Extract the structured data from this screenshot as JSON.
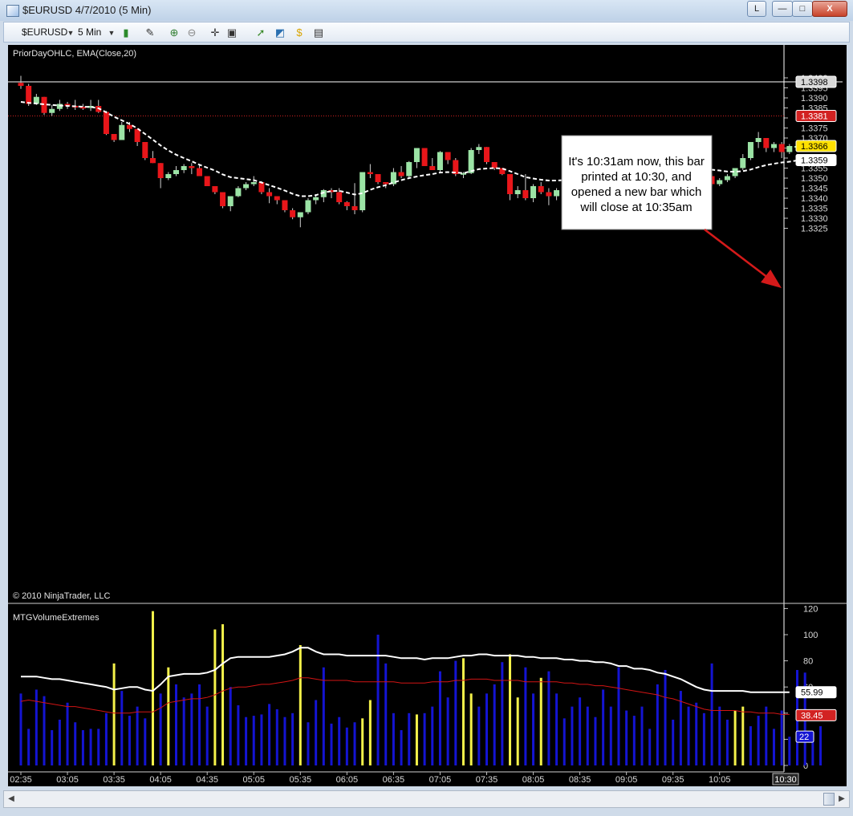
{
  "window": {
    "title": "$EURUSD  4/7/2010 (5 Min)",
    "controls": {
      "shortcut": "L",
      "minimize": "—",
      "maximize": "□",
      "close": "X"
    }
  },
  "toolbar": {
    "instrument": "$EURUSD",
    "interval": "5 Min"
  },
  "colors": {
    "background": "#000000",
    "up": "#9be3a5",
    "down": "#e8161a",
    "ema": "#ffffff",
    "volume_normal": "#1414d2",
    "volume_extreme": "#f5f24a",
    "band_upper": "#ffffff",
    "band_lower": "#d21414"
  },
  "chart_data": [
    {
      "type": "candlestick",
      "indicator_label": "PriorDayOHLC, EMA(Close,20)",
      "copyright": "© 2010 NinjaTrader, LLC",
      "ylim": [
        1.3322,
        1.3404
      ],
      "y_ticks": [
        "1.3400",
        "1.3395",
        "1.3390",
        "1.3385",
        "1.3380",
        "1.3375",
        "1.3370",
        "1.3365",
        "1.3360",
        "1.3355",
        "1.3350",
        "1.3345",
        "1.3340",
        "1.3335",
        "1.3330",
        "1.3325"
      ],
      "x_ticks": [
        "02:35",
        "03:05",
        "03:35",
        "04:05",
        "04:35",
        "05:05",
        "05:35",
        "06:05",
        "06:35",
        "07:05",
        "07:35",
        "08:05",
        "08:35",
        "09:05",
        "09:35",
        "10:05"
      ],
      "last_time_label": "10:30",
      "prior_high": 1.3398,
      "prior_close": 1.3381,
      "last_price": 1.3366,
      "ema_value": 1.3359,
      "price_labels": {
        "prior_high": "1.3398",
        "prior_close": "1.3381",
        "last": "1.3366",
        "ema": "1.3359"
      },
      "candles": [
        [
          1.33975,
          1.3401,
          1.33945,
          1.3396
        ],
        [
          1.3396,
          1.3397,
          1.3386,
          1.3387
        ],
        [
          1.3387,
          1.3392,
          1.33865,
          1.33905
        ],
        [
          1.33905,
          1.33905,
          1.33815,
          1.33825
        ],
        [
          1.33825,
          1.33865,
          1.3381,
          1.33845
        ],
        [
          1.33845,
          1.3389,
          1.33835,
          1.3387
        ],
        [
          1.3387,
          1.3388,
          1.33845,
          1.3386
        ],
        [
          1.3386,
          1.3389,
          1.3384,
          1.33855
        ],
        [
          1.33855,
          1.3387,
          1.3384,
          1.3385
        ],
        [
          1.3385,
          1.3389,
          1.33835,
          1.3386
        ],
        [
          1.3386,
          1.3389,
          1.33825,
          1.3383
        ],
        [
          1.3383,
          1.33835,
          1.33715,
          1.3372
        ],
        [
          1.3372,
          1.3372,
          1.3368,
          1.3369
        ],
        [
          1.3369,
          1.3378,
          1.3369,
          1.33765
        ],
        [
          1.33765,
          1.3378,
          1.3373,
          1.33745
        ],
        [
          1.33745,
          1.33745,
          1.3366,
          1.3368
        ],
        [
          1.3368,
          1.3368,
          1.3359,
          1.336
        ],
        [
          1.336,
          1.33635,
          1.33575,
          1.33575
        ],
        [
          1.33575,
          1.33575,
          1.3345,
          1.335
        ],
        [
          1.335,
          1.3353,
          1.3349,
          1.3352
        ],
        [
          1.3352,
          1.3356,
          1.3351,
          1.3354
        ],
        [
          1.3354,
          1.3357,
          1.33525,
          1.3356
        ],
        [
          1.3356,
          1.33575,
          1.3352,
          1.3355
        ],
        [
          1.3355,
          1.3357,
          1.3351,
          1.3351
        ],
        [
          1.3351,
          1.3351,
          1.3346,
          1.3346
        ],
        [
          1.3346,
          1.3346,
          1.3342,
          1.3343
        ],
        [
          1.3343,
          1.3343,
          1.3335,
          1.3336
        ],
        [
          1.3336,
          1.3336,
          1.33335,
          1.3341
        ],
        [
          1.3341,
          1.3346,
          1.33405,
          1.3345
        ],
        [
          1.3345,
          1.3348,
          1.3344,
          1.3347
        ],
        [
          1.3347,
          1.3351,
          1.3346,
          1.3348
        ],
        [
          1.3348,
          1.33485,
          1.3342,
          1.3343
        ],
        [
          1.3343,
          1.3345,
          1.33375,
          1.3341
        ],
        [
          1.3341,
          1.3341,
          1.3337,
          1.3339
        ],
        [
          1.3339,
          1.3339,
          1.3333,
          1.3334
        ],
        [
          1.3334,
          1.3335,
          1.33295,
          1.33305
        ],
        [
          1.33305,
          1.3333,
          1.33255,
          1.3333
        ],
        [
          1.3333,
          1.334,
          1.3332,
          1.3339
        ],
        [
          1.3339,
          1.3342,
          1.3337,
          1.33405
        ],
        [
          1.33405,
          1.33445,
          1.3338,
          1.3344
        ],
        [
          1.3344,
          1.3345,
          1.334,
          1.3343
        ],
        [
          1.3343,
          1.3345,
          1.3337,
          1.3338
        ],
        [
          1.3338,
          1.33385,
          1.3334,
          1.3336
        ],
        [
          1.3336,
          1.33475,
          1.3332,
          1.3334
        ],
        [
          1.3334,
          1.3353,
          1.3333,
          1.3353
        ],
        [
          1.3353,
          1.3357,
          1.335,
          1.3352
        ],
        [
          1.3352,
          1.3352,
          1.3347,
          1.3348
        ],
        [
          1.3348,
          1.3348,
          1.3345,
          1.3347
        ],
        [
          1.3347,
          1.3355,
          1.3346,
          1.3353
        ],
        [
          1.3353,
          1.3356,
          1.335,
          1.3351
        ],
        [
          1.3351,
          1.33585,
          1.335,
          1.3358
        ],
        [
          1.3358,
          1.3365,
          1.3355,
          1.3365
        ],
        [
          1.3365,
          1.3365,
          1.3356,
          1.3356
        ],
        [
          1.3356,
          1.336,
          1.3354,
          1.3354
        ],
        [
          1.3354,
          1.33635,
          1.3353,
          1.3363
        ],
        [
          1.3363,
          1.3363,
          1.3357,
          1.3359
        ],
        [
          1.3359,
          1.336,
          1.3351,
          1.3352
        ],
        [
          1.3352,
          1.3353,
          1.335,
          1.33525
        ],
        [
          1.33525,
          1.3365,
          1.3352,
          1.3364
        ],
        [
          1.3364,
          1.3367,
          1.3362,
          1.33655
        ],
        [
          1.33655,
          1.33655,
          1.3357,
          1.3358
        ],
        [
          1.3358,
          1.3358,
          1.3354,
          1.3355
        ],
        [
          1.3355,
          1.3355,
          1.33515,
          1.3352
        ],
        [
          1.3352,
          1.3352,
          1.3339,
          1.3342
        ],
        [
          1.3342,
          1.3346,
          1.334,
          1.3344
        ],
        [
          1.3344,
          1.3352,
          1.3339,
          1.334
        ],
        [
          1.334,
          1.3347,
          1.3338,
          1.3346
        ],
        [
          1.3346,
          1.3348,
          1.3342,
          1.3343
        ],
        [
          1.3343,
          1.3345,
          1.33365,
          1.3341
        ],
        [
          1.3341,
          1.3345,
          1.3339,
          1.3344
        ],
        [
          1.3344,
          1.3348,
          1.3341,
          1.3347
        ],
        [
          1.3347,
          1.335,
          1.3346,
          1.3349
        ],
        [
          1.3349,
          1.3356,
          1.3348,
          1.3355
        ],
        [
          1.3355,
          1.3358,
          1.3352,
          1.3353
        ],
        [
          1.3353,
          1.3359,
          1.335,
          1.3359
        ],
        [
          1.3359,
          1.3359,
          1.3349,
          1.3351
        ],
        [
          1.3351,
          1.3355,
          1.3347,
          1.3355
        ],
        [
          1.3355,
          1.3356,
          1.335,
          1.3353
        ],
        [
          1.3353,
          1.3355,
          1.3351,
          1.3354
        ],
        [
          1.3354,
          1.3361,
          1.3353,
          1.336
        ],
        [
          1.336,
          1.3364,
          1.3358,
          1.3363
        ],
        [
          1.3363,
          1.3365,
          1.336,
          1.3361
        ],
        [
          1.3361,
          1.3365,
          1.336,
          1.3364
        ],
        [
          1.3364,
          1.3366,
          1.3362,
          1.3365
        ],
        [
          1.3365,
          1.3366,
          1.3359,
          1.3361
        ],
        [
          1.3361,
          1.3362,
          1.3358,
          1.336
        ],
        [
          1.336,
          1.336,
          1.3355,
          1.3356
        ],
        [
          1.3356,
          1.3356,
          1.3352,
          1.3353
        ],
        [
          1.3353,
          1.3353,
          1.335,
          1.3351
        ],
        [
          1.3351,
          1.3352,
          1.3346,
          1.3347
        ],
        [
          1.3347,
          1.335,
          1.3346,
          1.3349
        ],
        [
          1.3349,
          1.3352,
          1.3348,
          1.3351
        ],
        [
          1.3351,
          1.33535,
          1.335,
          1.3355
        ],
        [
          1.3355,
          1.3362,
          1.3354,
          1.336
        ],
        [
          1.336,
          1.3368,
          1.3359,
          1.3368
        ],
        [
          1.3368,
          1.3373,
          1.3365,
          1.337
        ],
        [
          1.337,
          1.337,
          1.3363,
          1.3365
        ],
        [
          1.3365,
          1.3368,
          1.3363,
          1.3367
        ],
        [
          1.3367,
          1.3368,
          1.336,
          1.3363
        ],
        [
          1.3363,
          1.3367,
          1.3362,
          1.3366
        ],
        [
          1.3366,
          1.3366,
          1.3366,
          1.3366
        ]
      ],
      "ema": [
        1.3388,
        1.33875,
        1.33872,
        1.33868,
        1.33865,
        1.33862,
        1.3386,
        1.33858,
        1.33856,
        1.33855,
        1.33848,
        1.33828,
        1.33806,
        1.33788,
        1.3377,
        1.33748,
        1.3372,
        1.33692,
        1.33663,
        1.33638,
        1.33617,
        1.336,
        1.33584,
        1.33567,
        1.33552,
        1.33538,
        1.33518,
        1.33505,
        1.335,
        1.33495,
        1.3349,
        1.33478,
        1.33465,
        1.33452,
        1.33438,
        1.33422,
        1.3341,
        1.3341,
        1.33415,
        1.33428,
        1.33435,
        1.33437,
        1.33428,
        1.33418,
        1.33425,
        1.33442,
        1.33455,
        1.33465,
        1.33478,
        1.3349,
        1.335,
        1.33508,
        1.33515,
        1.3352,
        1.33528,
        1.3353,
        1.33528,
        1.33525,
        1.33535,
        1.33545,
        1.33548,
        1.3355,
        1.33548,
        1.33535,
        1.3352,
        1.33505,
        1.33498,
        1.33492,
        1.33488,
        1.33488,
        1.3349,
        1.33493,
        1.33499,
        1.33502,
        1.33508,
        1.33512,
        1.33518,
        1.3352,
        1.33525,
        1.33533,
        1.33542,
        1.33548,
        1.33553,
        1.33558,
        1.33562,
        1.33562,
        1.33558,
        1.33553,
        1.33548,
        1.33542,
        1.33538,
        1.33533,
        1.33532,
        1.33535,
        1.33543,
        1.33555,
        1.33565,
        1.33572,
        1.33578,
        1.33582,
        1.33588
      ]
    },
    {
      "type": "bar",
      "indicator_label": "MTGVolumeExtremes",
      "ylim": [
        0,
        120
      ],
      "y_ticks": [
        "120",
        "100",
        "80",
        "60",
        "40",
        "20",
        "0"
      ],
      "last_values": {
        "upper": "55.99",
        "lower": "38.45",
        "volume": "22"
      },
      "volume": [
        55,
        28,
        58,
        53,
        27,
        35,
        48,
        33,
        27,
        28,
        28,
        40,
        78,
        57,
        38,
        45,
        36,
        118,
        55,
        75,
        62,
        52,
        55,
        62,
        45,
        104,
        108,
        60,
        46,
        37,
        38,
        39,
        47,
        43,
        37,
        40,
        92,
        33,
        50,
        75,
        32,
        37,
        29,
        33,
        36,
        50,
        100,
        78,
        40,
        27,
        40,
        39,
        40,
        45,
        72,
        52,
        80,
        82,
        55,
        45,
        55,
        62,
        79,
        85,
        52,
        75,
        55,
        67,
        72,
        55,
        36,
        45,
        52,
        45,
        37,
        58,
        45,
        75,
        42,
        38,
        45,
        28,
        62,
        73,
        35,
        57,
        45,
        48,
        40,
        78,
        45,
        35,
        42,
        45,
        30,
        38,
        45,
        28,
        42,
        22,
        73,
        71,
        22,
        30
      ],
      "extreme": [
        12,
        17,
        19,
        25,
        26,
        36,
        44,
        45,
        51,
        57,
        58,
        63,
        64,
        67,
        92,
        93
      ],
      "upper_band": [
        68,
        68,
        68,
        67,
        66,
        66,
        65,
        64,
        63,
        62,
        61,
        60,
        58,
        59,
        60,
        60,
        58,
        57,
        62,
        68,
        69,
        70,
        70,
        70,
        71,
        73,
        78,
        82,
        83,
        83,
        83,
        83,
        83,
        84,
        85,
        87,
        90,
        90,
        87,
        85,
        85,
        85,
        84,
        84,
        84,
        84,
        84,
        84,
        83,
        82,
        82,
        82,
        81,
        82,
        82,
        82,
        83,
        84,
        84,
        85,
        85,
        84,
        84,
        84,
        84,
        83,
        83,
        82,
        82,
        82,
        81,
        81,
        80,
        80,
        79,
        79,
        78,
        76,
        76,
        74,
        74,
        73,
        71,
        70,
        68,
        66,
        63,
        60,
        58,
        57,
        57,
        57,
        57,
        57,
        56,
        56,
        56,
        56,
        56,
        56
      ],
      "lower_band": [
        49,
        50,
        49,
        48,
        47,
        46,
        45,
        45,
        44,
        43,
        42,
        41,
        40,
        40,
        40,
        41,
        41,
        41,
        44,
        48,
        49,
        50,
        51,
        51,
        52,
        54,
        57,
        59,
        60,
        60,
        61,
        62,
        62,
        63,
        64,
        65,
        67,
        67,
        66,
        65,
        65,
        65,
        65,
        64,
        64,
        64,
        64,
        64,
        64,
        63,
        63,
        63,
        63,
        64,
        64,
        64,
        65,
        65,
        66,
        66,
        66,
        65,
        65,
        65,
        65,
        64,
        64,
        64,
        64,
        64,
        63,
        63,
        62,
        62,
        61,
        61,
        60,
        59,
        58,
        57,
        56,
        55,
        54,
        52,
        51,
        49,
        47,
        45,
        43,
        42,
        42,
        42,
        42,
        41,
        41,
        40,
        40,
        40,
        39,
        39
      ]
    }
  ],
  "annotation": {
    "lines": [
      "It's 10:31am now, this bar",
      "printed at 10:30, and",
      "opened a new bar which",
      "will close at 10:35am"
    ]
  }
}
